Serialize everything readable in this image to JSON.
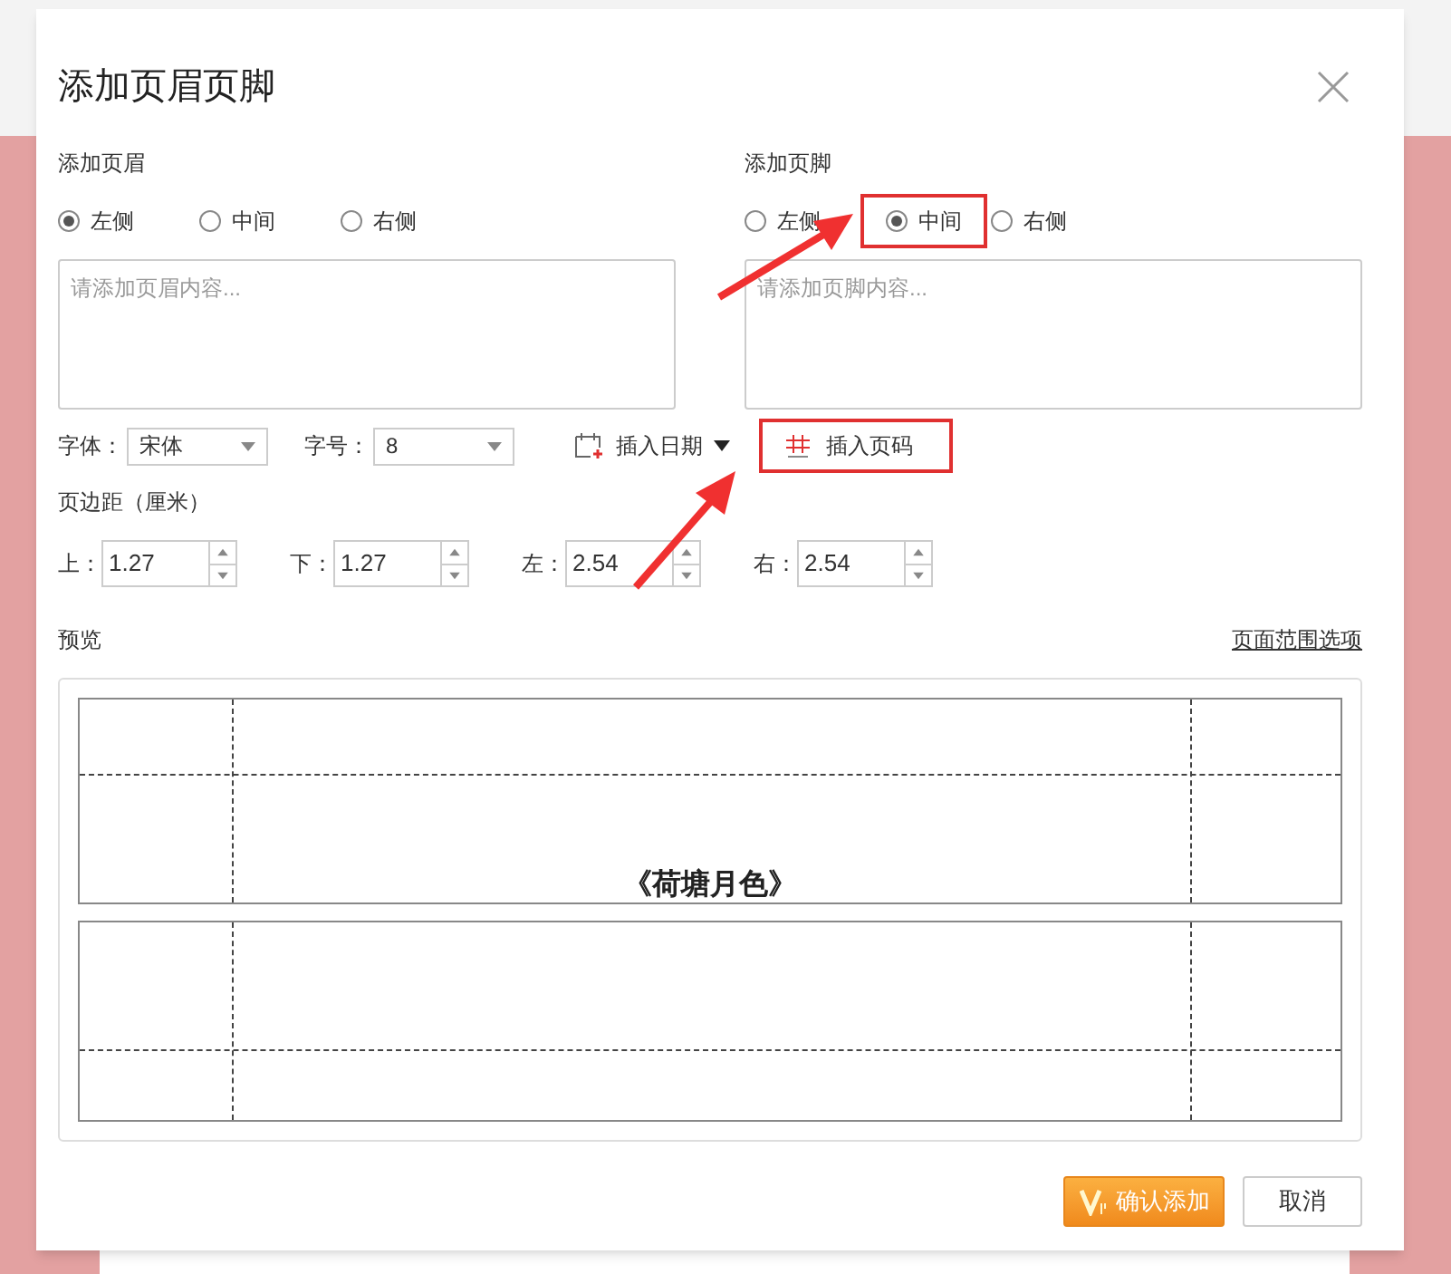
{
  "dialog": {
    "title": "添加页眉页脚",
    "header": {
      "label": "添加页眉",
      "positions": [
        {
          "label": "左侧",
          "selected": true
        },
        {
          "label": "中间",
          "selected": false
        },
        {
          "label": "右侧",
          "selected": false
        }
      ],
      "placeholder": "请添加页眉内容..."
    },
    "footer": {
      "label": "添加页脚",
      "positions": [
        {
          "label": "左侧",
          "selected": false
        },
        {
          "label": "中间",
          "selected": true,
          "highlighted": true
        },
        {
          "label": "右侧",
          "selected": false
        }
      ],
      "placeholder": "请添加页脚内容..."
    },
    "font": {
      "label": "字体：",
      "value": "宋体"
    },
    "size": {
      "label": "字号：",
      "value": "8"
    },
    "insert_date": {
      "label": "插入日期"
    },
    "insert_page_number": {
      "label": "插入页码",
      "highlighted": true
    },
    "margins": {
      "label": "页边距（厘米）",
      "fields": [
        {
          "label": "上：",
          "value": "1.27"
        },
        {
          "label": "下：",
          "value": "1.27"
        },
        {
          "label": "左：",
          "value": "2.54"
        },
        {
          "label": "右：",
          "value": "2.54"
        }
      ]
    },
    "preview": {
      "label": "预览",
      "link": "页面范围选项",
      "document_title": "《荷塘月色》"
    },
    "buttons": [
      {
        "label": "确认添加",
        "kind": "primary"
      },
      {
        "label": "取消",
        "kind": "secondary"
      }
    ]
  }
}
